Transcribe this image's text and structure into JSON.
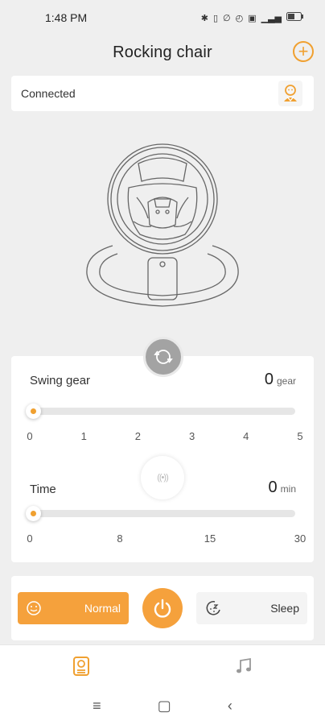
{
  "status_bar": {
    "time": "1:48 PM",
    "icons": [
      "bluetooth-icon",
      "vibrate-icon",
      "mute-icon",
      "alarm-icon",
      "nfc-icon",
      "signal-icon",
      "battery-icon"
    ]
  },
  "header": {
    "title": "Rocking chair"
  },
  "connection": {
    "status": "Connected"
  },
  "swing": {
    "label": "Swing gear",
    "value": "0",
    "unit": "gear",
    "level": 0,
    "ticks": [
      "0",
      "1",
      "2",
      "3",
      "4",
      "5"
    ]
  },
  "time": {
    "label": "Time",
    "value": "0",
    "unit": "min",
    "level": 0,
    "ticks": [
      "0",
      "8",
      "15",
      "30"
    ]
  },
  "modes": {
    "normal_label": "Normal",
    "sleep_label": "Sleep"
  },
  "colors": {
    "accent": "#f5a13c",
    "track": "#e6e6e6"
  }
}
